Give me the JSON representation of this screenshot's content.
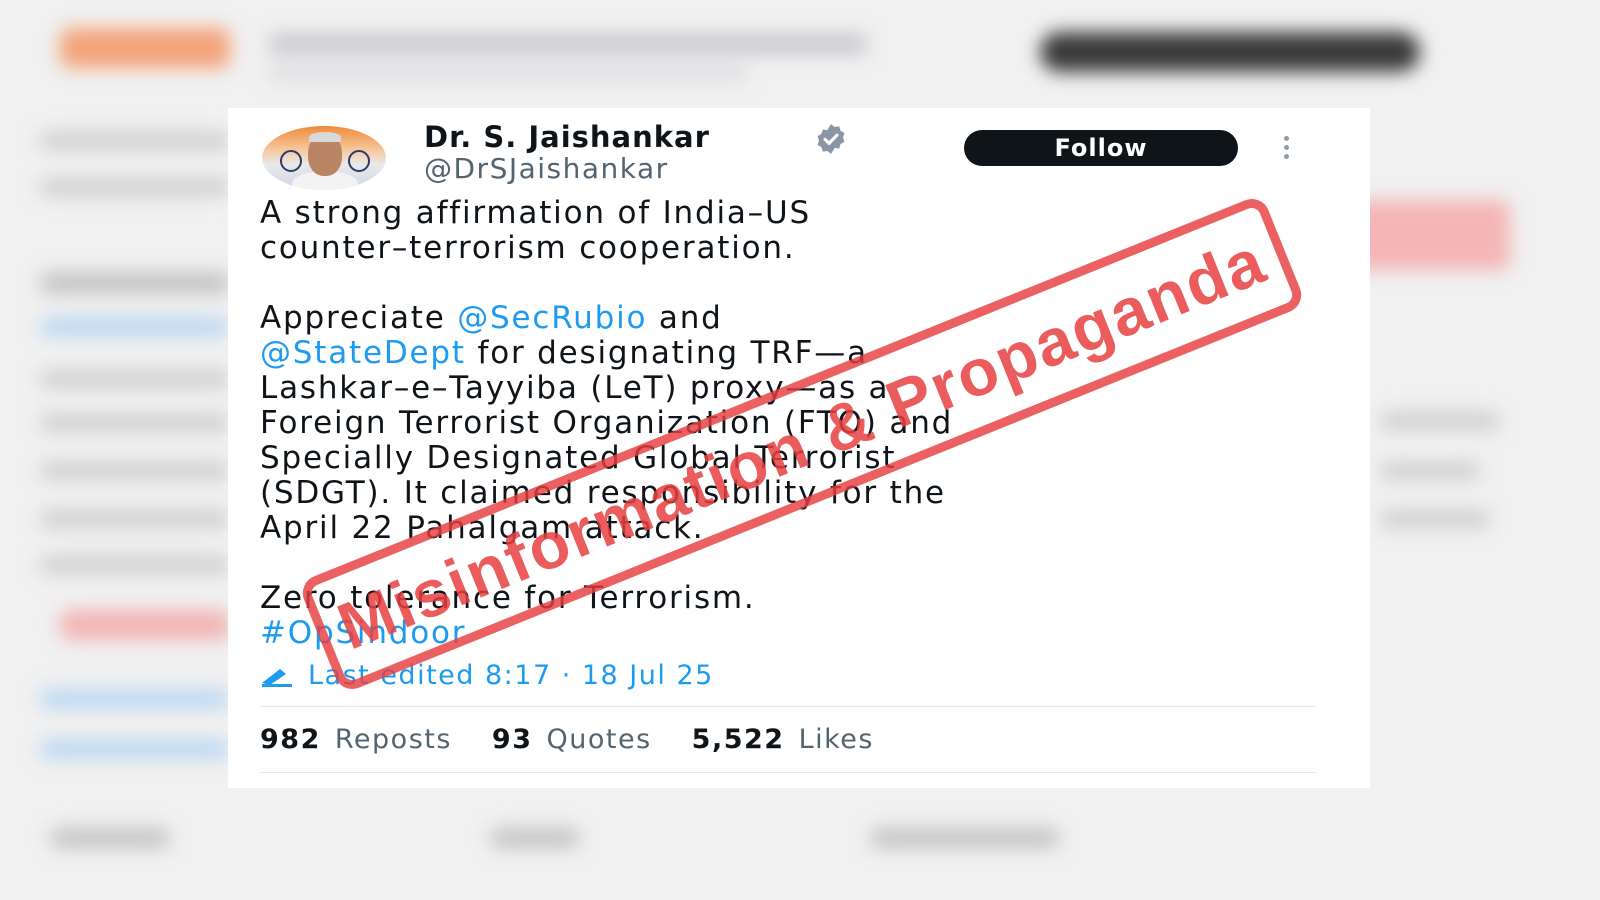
{
  "author": {
    "display_name": "Dr. S. Jaishankar",
    "handle": "@DrSJaishankar",
    "verified_icon": "verified-badge-icon",
    "avatar_icon": "profile-avatar"
  },
  "actions": {
    "follow_label": "Follow",
    "more_icon": "more-options-icon"
  },
  "tweet": {
    "line1": "A strong affirmation of India–US",
    "line2": "counter–terrorism cooperation.",
    "p2_prefix": "Appreciate ",
    "mention1": "@SecRubio",
    "p2_mid": " and",
    "mention2": "@StateDept",
    "p2_line2_rest": " for designating TRF—a",
    "p2_line3": "Lashkar–e–Tayyiba (LeT) proxy—as a",
    "p2_line4": "Foreign Terrorist Organization (FTO) and",
    "p2_line5": "Specially Designated Global Terrorist",
    "p2_line6": "(SDGT). It claimed responsibility for the",
    "p2_line7": "April 22 Pahalgam attack.",
    "p3_line1": "Zero tolerance for Terrorism.",
    "hashtag": "#OpSindoor",
    "edited_text": "Last edited 8:17 · 18 Jul 25",
    "edit_icon": "pencil-edit-icon"
  },
  "stats": [
    {
      "value": "982",
      "label": "Reposts"
    },
    {
      "value": "93",
      "label": "Quotes"
    },
    {
      "value": "5,522",
      "label": "Likes"
    }
  ],
  "stamp": {
    "text": "Misinformation & Propaganda",
    "color": "#e63e3e"
  },
  "colors": {
    "link": "#1d9bf0",
    "text": "#0f1419",
    "secondary": "#536471",
    "button_bg": "#0f1419"
  }
}
